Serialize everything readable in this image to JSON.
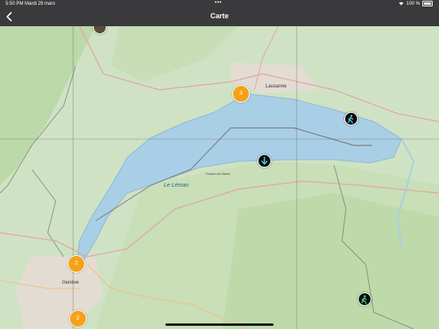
{
  "status_bar": {
    "time": "5:50 PM",
    "date": "Mardi 29 mars",
    "battery": "100 %"
  },
  "nav": {
    "title": "Carte"
  },
  "map": {
    "place_labels": {
      "lausanne": "Lausanne",
      "le_leman": "Le Léman",
      "geneve": "Genève",
      "thonon": "Thonon-les-Bains"
    },
    "clusters": [
      {
        "id": "a",
        "count": "3"
      },
      {
        "id": "b",
        "count": "2"
      },
      {
        "id": "c",
        "count": "2"
      }
    ],
    "markers": [
      {
        "id": "vevey",
        "icon": "hiker-icon"
      },
      {
        "id": "lake",
        "icon": "down-arrow-icon"
      },
      {
        "id": "alps",
        "icon": "hiker-icon"
      }
    ]
  },
  "colors": {
    "bar": "#3a3a3c",
    "lake": "#a9cfe6",
    "land": "#cfe3c4",
    "cluster": "#f5a21a",
    "marker": "#0c0c0c"
  }
}
